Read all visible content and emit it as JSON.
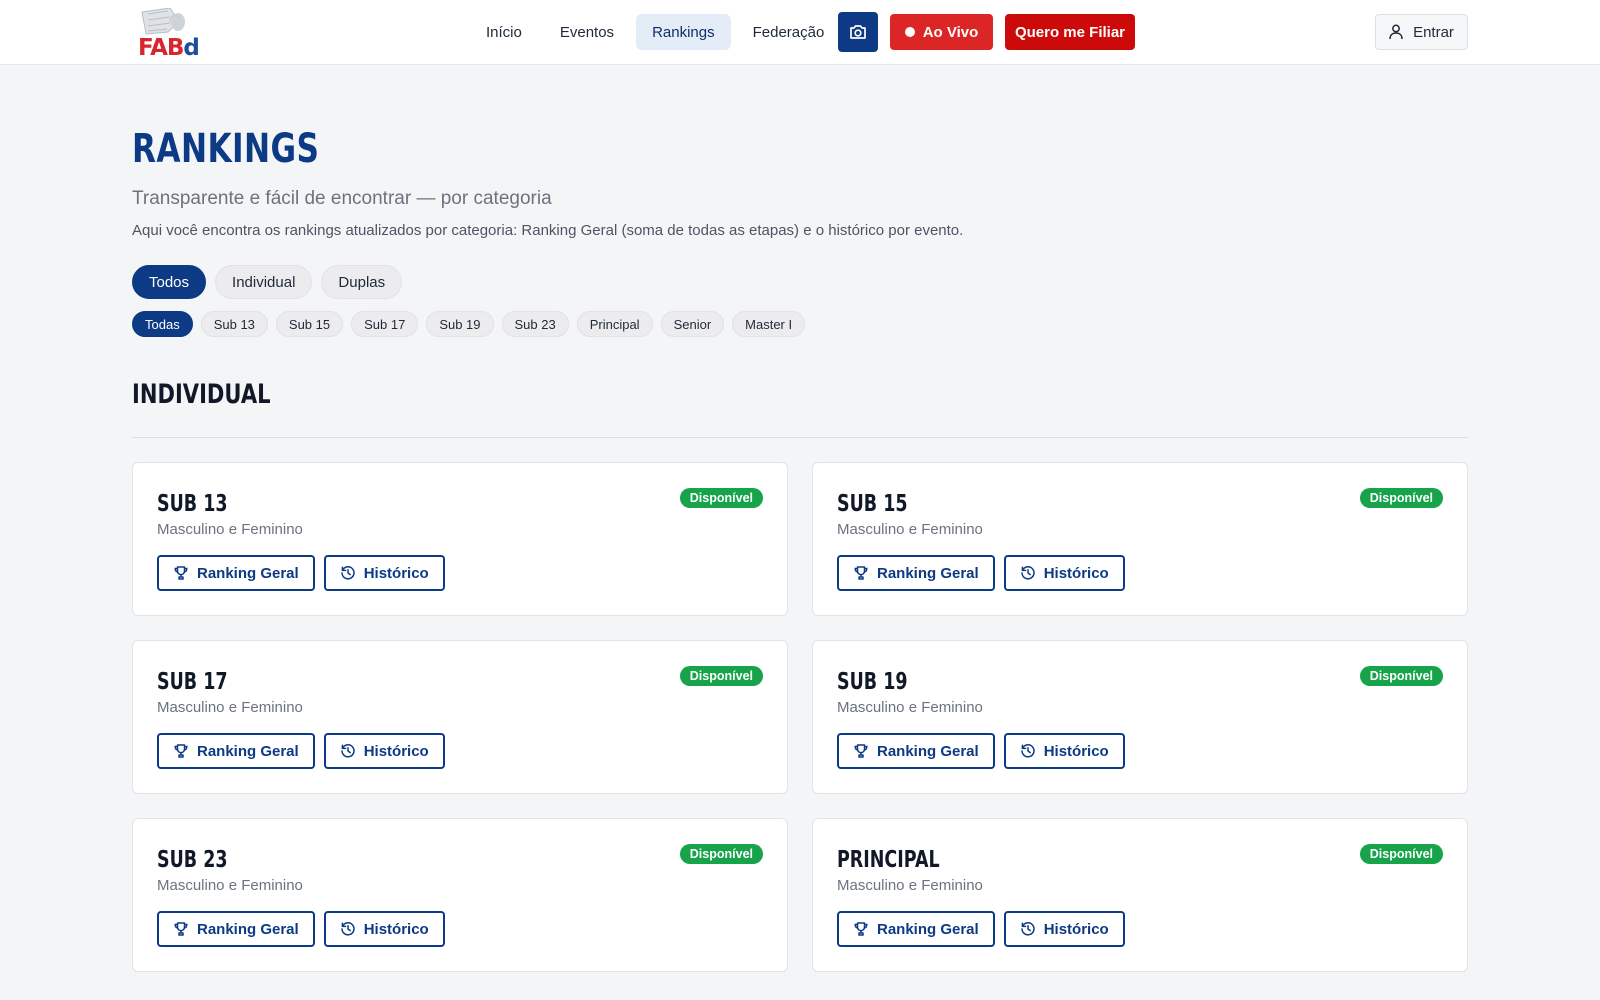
{
  "header": {
    "logo_text_red": "FAB",
    "logo_text_blue": "d",
    "nav": [
      {
        "label": "Início",
        "active": false
      },
      {
        "label": "Eventos",
        "active": false
      },
      {
        "label": "Rankings",
        "active": true
      },
      {
        "label": "Federação",
        "active": false
      }
    ],
    "camera_icon": "camera-icon",
    "live_label": "Ao Vivo",
    "join_label": "Quero me Filiar",
    "login_label": "Entrar",
    "login_icon": "user-icon"
  },
  "page": {
    "title": "RANKINGS",
    "subtitle": "Transparente e fácil de encontrar — por categoria",
    "description": "Aqui você encontra os rankings atualizados por categoria: Ranking Geral (soma de todas as etapas) e o histórico por evento."
  },
  "filters": {
    "types": [
      {
        "label": "Todos",
        "active": true
      },
      {
        "label": "Individual",
        "active": false
      },
      {
        "label": "Duplas",
        "active": false
      }
    ],
    "categories": [
      {
        "label": "Todas",
        "active": true
      },
      {
        "label": "Sub 13",
        "active": false
      },
      {
        "label": "Sub 15",
        "active": false
      },
      {
        "label": "Sub 17",
        "active": false
      },
      {
        "label": "Sub 19",
        "active": false
      },
      {
        "label": "Sub 23",
        "active": false
      },
      {
        "label": "Principal",
        "active": false
      },
      {
        "label": "Senior",
        "active": false
      },
      {
        "label": "Master I",
        "active": false
      }
    ]
  },
  "section": {
    "title": "INDIVIDUAL",
    "cards": [
      {
        "title": "SUB 13",
        "subtitle": "Masculino e Feminino",
        "badge": "Disponível",
        "primary": "Ranking Geral",
        "secondary": "Histórico"
      },
      {
        "title": "SUB 15",
        "subtitle": "Masculino e Feminino",
        "badge": "Disponível",
        "primary": "Ranking Geral",
        "secondary": "Histórico"
      },
      {
        "title": "SUB 17",
        "subtitle": "Masculino e Feminino",
        "badge": "Disponível",
        "primary": "Ranking Geral",
        "secondary": "Histórico"
      },
      {
        "title": "SUB 19",
        "subtitle": "Masculino e Feminino",
        "badge": "Disponível",
        "primary": "Ranking Geral",
        "secondary": "Histórico"
      },
      {
        "title": "SUB 23",
        "subtitle": "Masculino e Feminino",
        "badge": "Disponível",
        "primary": "Ranking Geral",
        "secondary": "Histórico"
      },
      {
        "title": "PRINCIPAL",
        "subtitle": "Masculino e Feminino",
        "badge": "Disponível",
        "primary": "Ranking Geral",
        "secondary": "Histórico"
      }
    ]
  },
  "colors": {
    "brand_blue": "#0d3a84",
    "live_red": "#dc2626",
    "join_red": "#cc0a0a",
    "available_green": "#16a34a"
  }
}
